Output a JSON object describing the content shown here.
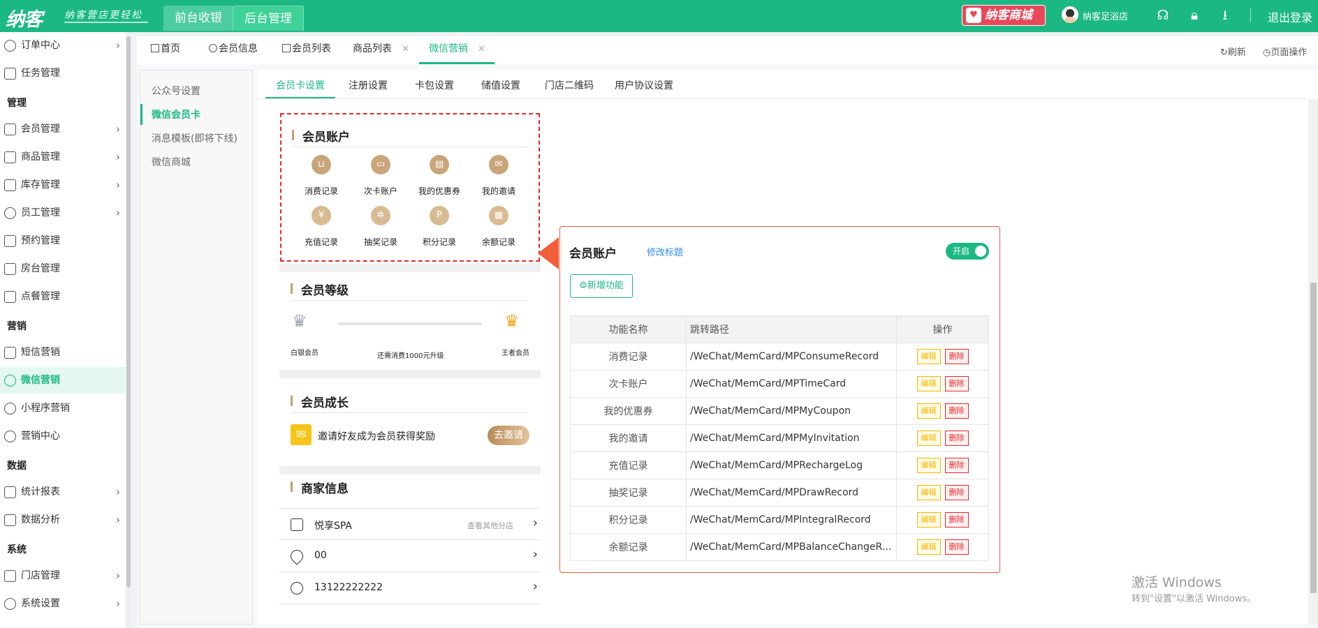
{
  "topbar": {
    "logo": "纳客",
    "slogan": "纳客营店更轻松",
    "nav": [
      "前台收银",
      "后台管理"
    ],
    "mall_label": "纳客商城",
    "store_name": "纳客足浴店",
    "logout": "退出登录",
    "icons": [
      "headset-icon",
      "lock-icon",
      "download-icon"
    ]
  },
  "sidebar": {
    "items": [
      {
        "label": "订单中心",
        "icon": "order-icon",
        "chevron": true
      },
      {
        "label": "任务管理",
        "icon": "task-icon",
        "chevron": false
      },
      {
        "group": "管理"
      },
      {
        "label": "会员管理",
        "icon": "crown-icon",
        "chevron": true
      },
      {
        "label": "商品管理",
        "icon": "goods-icon",
        "chevron": true
      },
      {
        "label": "库存管理",
        "icon": "stock-icon",
        "chevron": true
      },
      {
        "label": "员工管理",
        "icon": "staff-icon",
        "chevron": true
      },
      {
        "label": "预约管理",
        "icon": "calendar-icon",
        "chevron": false
      },
      {
        "label": "房台管理",
        "icon": "room-icon",
        "chevron": false
      },
      {
        "label": "点餐管理",
        "icon": "dining-icon",
        "chevron": false
      },
      {
        "group": "营销"
      },
      {
        "label": "短信营销",
        "icon": "sms-icon",
        "chevron": false
      },
      {
        "label": "微信营销",
        "icon": "wechat-icon",
        "chevron": false,
        "active": true
      },
      {
        "label": "小程序营销",
        "icon": "miniprogram-icon",
        "chevron": false
      },
      {
        "label": "营销中心",
        "icon": "target-icon",
        "chevron": false
      },
      {
        "group": "数据"
      },
      {
        "label": "统计报表",
        "icon": "chart-icon",
        "chevron": true
      },
      {
        "label": "数据分析",
        "icon": "analysis-icon",
        "chevron": true
      },
      {
        "group": "系统"
      },
      {
        "label": "门店管理",
        "icon": "store-icon",
        "chevron": true
      },
      {
        "label": "系统设置",
        "icon": "settings-icon",
        "chevron": true
      }
    ]
  },
  "tabs": [
    {
      "label": "首页",
      "closable": false
    },
    {
      "label": "会员信息",
      "closable": false
    },
    {
      "label": "会员列表",
      "closable": false
    },
    {
      "label": "商品列表",
      "closable": true
    },
    {
      "label": "微信营销",
      "closable": true,
      "active": true
    }
  ],
  "tab_tools": {
    "refresh": "刷新",
    "page_ops": "页面操作"
  },
  "left_menu": [
    "公众号设置",
    "微信会员卡",
    "消息模板(即将下线)",
    "微信商城"
  ],
  "subtabs": [
    "会员卡设置",
    "注册设置",
    "卡包设置",
    "储值设置",
    "门店二维码",
    "用户协议设置"
  ],
  "preview": {
    "account": {
      "title": "会员账户",
      "items": [
        "消费记录",
        "次卡账户",
        "我的优惠券",
        "我的邀请",
        "充值记录",
        "抽奖记录",
        "积分记录",
        "余额记录"
      ]
    },
    "level": {
      "title": "会员等级",
      "from": "白银会员",
      "to": "王者会员",
      "hint": "还需消费1000元升级"
    },
    "growth": {
      "title": "会员成长",
      "text": "邀请好友成为会员获得奖励",
      "button": "去邀请"
    },
    "merchant": {
      "title": "商家信息",
      "name": "悦享SPA",
      "other_branches": "查看其他分店",
      "address": "00",
      "phone": "13122222222"
    }
  },
  "edit_panel": {
    "title": "会员账户",
    "rename": "修改标题",
    "toggle": "开启",
    "add_button": "新增功能",
    "columns": [
      "功能名称",
      "跳转路径",
      "操作"
    ],
    "edit_label": "编辑",
    "delete_label": "删除",
    "rows": [
      {
        "name": "消费记录",
        "path": "/WeChat/MemCard/MPConsumeRecord"
      },
      {
        "name": "次卡账户",
        "path": "/WeChat/MemCard/MPTimeCard"
      },
      {
        "name": "我的优惠券",
        "path": "/WeChat/MemCard/MPMyCoupon"
      },
      {
        "name": "我的邀请",
        "path": "/WeChat/MemCard/MPMyInvitation"
      },
      {
        "name": "充值记录",
        "path": "/WeChat/MemCard/MPRechargeLog"
      },
      {
        "name": "抽奖记录",
        "path": "/WeChat/MemCard/MPDrawRecord"
      },
      {
        "name": "积分记录",
        "path": "/WeChat/MemCard/MPIntegralRecord"
      },
      {
        "name": "余额记录",
        "path": "/WeChat/MemCard/MPBalanceChangeRe..."
      }
    ]
  },
  "watermark": {
    "line1": "激活 Windows",
    "line2": "转到\"设置\"以激活 Windows。"
  },
  "colors": {
    "brand": "#1cb884",
    "accent_gold": "#c6a06a",
    "panel_border": "#f25d3a",
    "danger": "#e32a2a"
  }
}
